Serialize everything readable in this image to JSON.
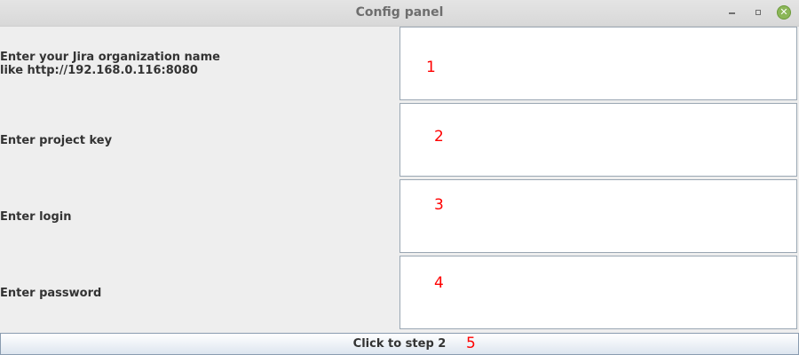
{
  "window": {
    "title": "Config panel",
    "icons": [
      "minimize-icon",
      "maximize-icon",
      "close-icon"
    ],
    "close_glyph": "✕",
    "accent_close": "#8bb658"
  },
  "form": {
    "org": {
      "label_line1": "Enter your Jira organization name",
      "label_line2": "like http://192.168.0.116:8080",
      "value": "",
      "annotation": "1"
    },
    "project_key": {
      "label": "Enter project key",
      "value": "",
      "annotation": "2"
    },
    "login": {
      "label": "Enter login",
      "value": "",
      "annotation": "3"
    },
    "password": {
      "label": "Enter password",
      "value": "",
      "annotation": "4"
    }
  },
  "step_button": {
    "label": "Click to step 2",
    "annotation": "5"
  },
  "colors": {
    "annotation": "#ff0000",
    "field_border": "#9aa7b3",
    "background": "#eeeeee"
  }
}
